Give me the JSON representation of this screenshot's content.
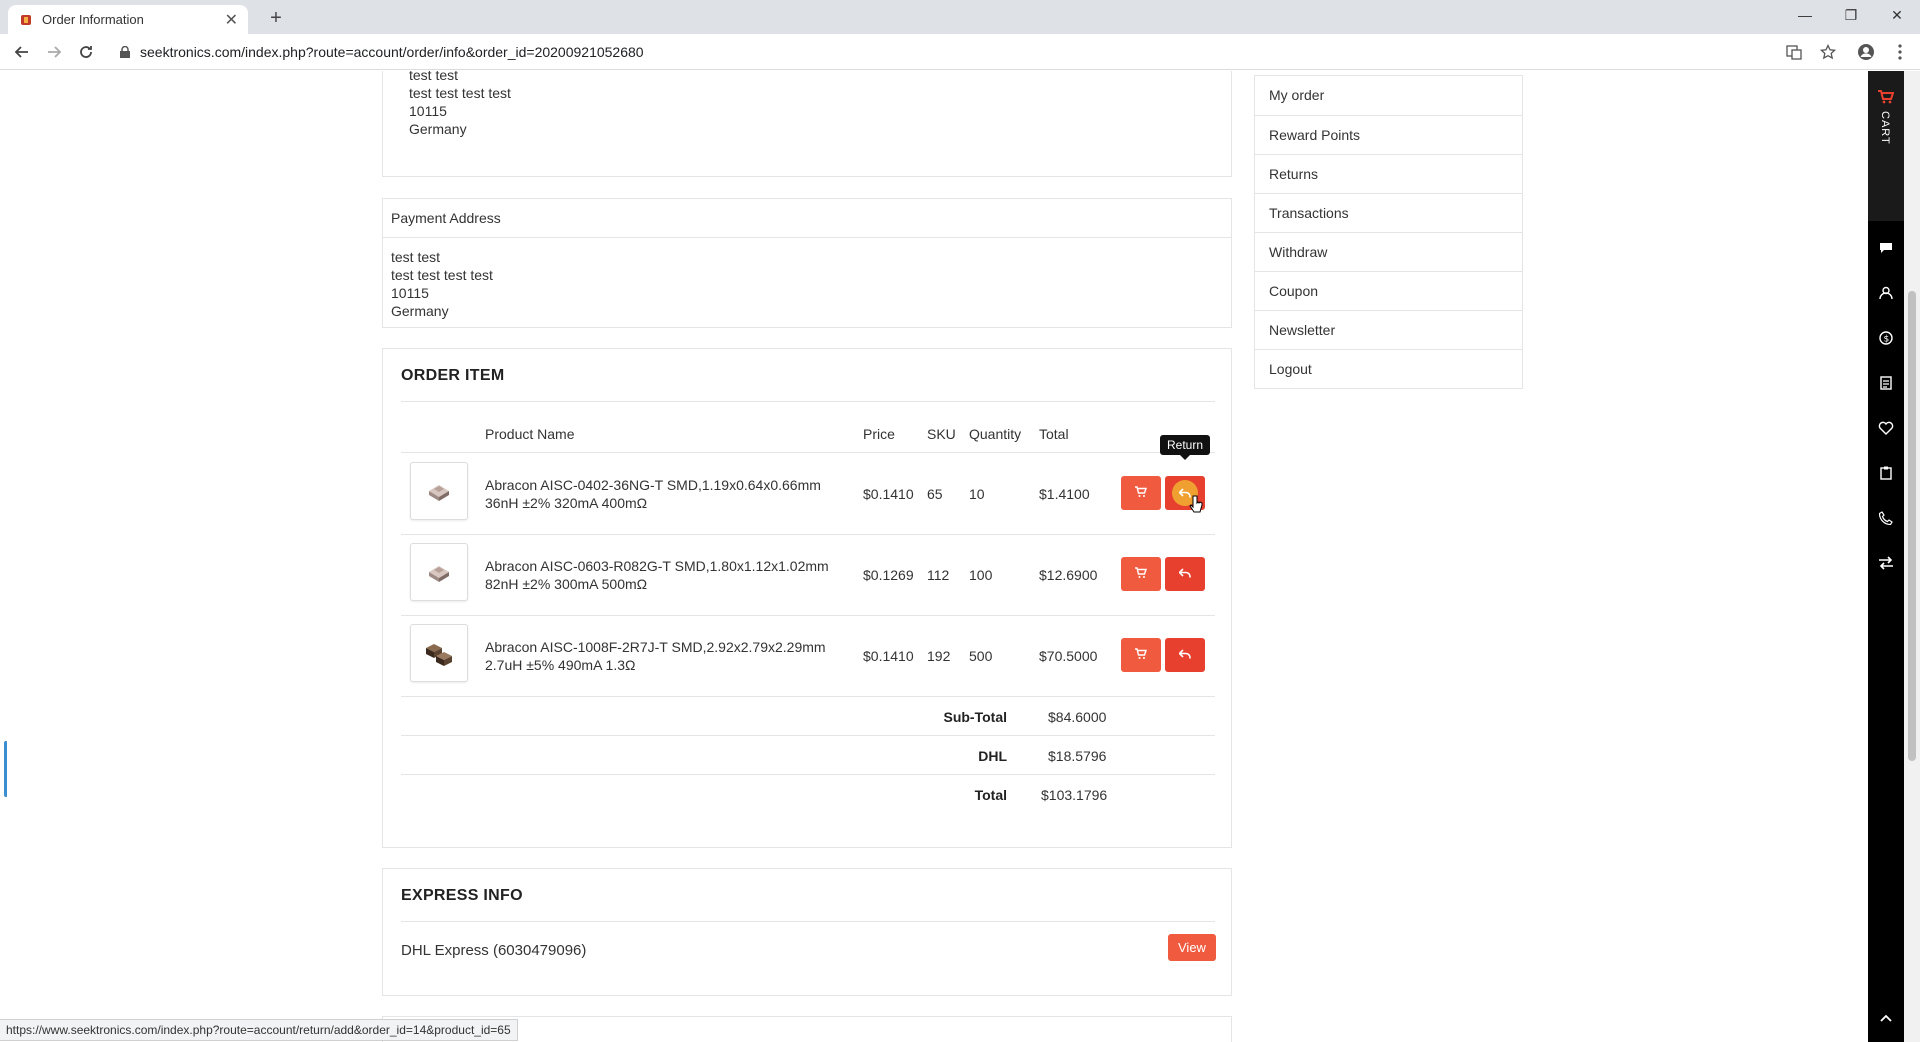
{
  "browser": {
    "tab_title": "Order Information",
    "url": "seektronics.com/index.php?route=account/order/info&order_id=20200921052680",
    "status_url": "https://www.seektronics.com/index.php?route=account/return/add&order_id=14&product_id=65"
  },
  "shipping_address": {
    "line0": "test test",
    "line1": "test test test test",
    "line2": "10115",
    "line3": "Germany"
  },
  "payment_address": {
    "header": "Payment Address",
    "line0": "test test",
    "line1": "test test test test",
    "line2": "10115",
    "line3": "Germany"
  },
  "order_items": {
    "title": "ORDER ITEM",
    "headers": {
      "product": "Product Name",
      "price": "Price",
      "sku": "SKU",
      "quantity": "Quantity",
      "total": "Total"
    },
    "rows": [
      {
        "name1": "Abracon AISC-0402-36NG-T SMD,1.19x0.64x0.66mm",
        "name2": "36nH ±2% 320mA 400mΩ",
        "price": "$0.1410",
        "sku": "65",
        "quantity": "10",
        "total": "$1.4100"
      },
      {
        "name1": "Abracon AISC-0603-R082G-T SMD,1.80x1.12x1.02mm",
        "name2": "82nH ±2% 300mA 500mΩ",
        "price": "$0.1269",
        "sku": "112",
        "quantity": "100",
        "total": "$12.6900"
      },
      {
        "name1": "Abracon AISC-1008F-2R7J-T SMD,2.92x2.79x2.29mm",
        "name2": "2.7uH ±5% 490mA 1.3Ω",
        "price": "$0.1410",
        "sku": "192",
        "quantity": "500",
        "total": "$70.5000"
      }
    ],
    "tooltip": "Return",
    "totals": {
      "subtotal_label": "Sub-Total",
      "subtotal": "$84.6000",
      "shipping_label": "DHL",
      "shipping": "$18.5796",
      "total_label": "Total",
      "total": "$103.1796"
    }
  },
  "express": {
    "title": "EXPRESS INFO",
    "carrier": "DHL Express (6030479096)",
    "view_label": "View"
  },
  "account_menu": [
    "My order",
    "Reward Points",
    "Returns",
    "Transactions",
    "Withdraw",
    "Coupon",
    "Newsletter",
    "Logout"
  ],
  "side_strip": {
    "cart_label": "CART"
  },
  "colors": {
    "accent": "#f05a3f",
    "return": "#e8402e"
  }
}
